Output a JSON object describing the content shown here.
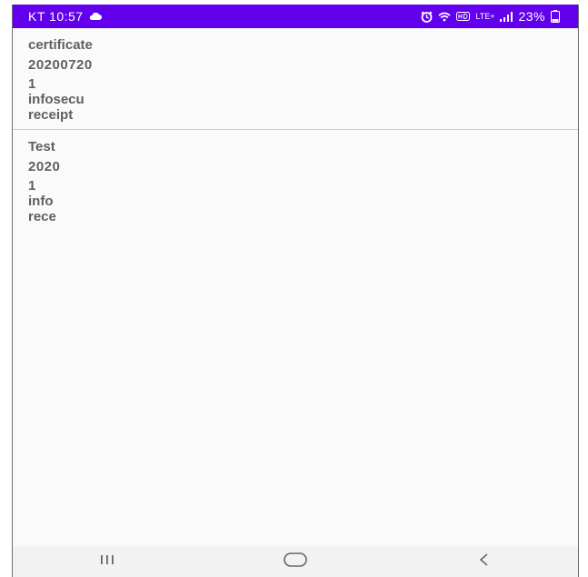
{
  "status_bar": {
    "carrier_time": "KT 10:57",
    "network": "LTE+",
    "battery": "23%",
    "bg_color": "#6200ee",
    "icons": [
      "cloud-icon",
      "alarm-icon",
      "wifi-icon",
      "hd-voice-icon",
      "lte-icon",
      "signal-icon",
      "battery-icon"
    ]
  },
  "list": {
    "items": [
      {
        "title": "certificate",
        "date": "20200720",
        "count": "1",
        "company": "infosecu",
        "type": "receipt"
      },
      {
        "title": "Test",
        "date": "2020",
        "count": "1",
        "company": "info",
        "type": "rece"
      }
    ]
  },
  "nav_bar": {
    "buttons": [
      "recent-apps-icon",
      "home-icon",
      "back-icon"
    ]
  }
}
